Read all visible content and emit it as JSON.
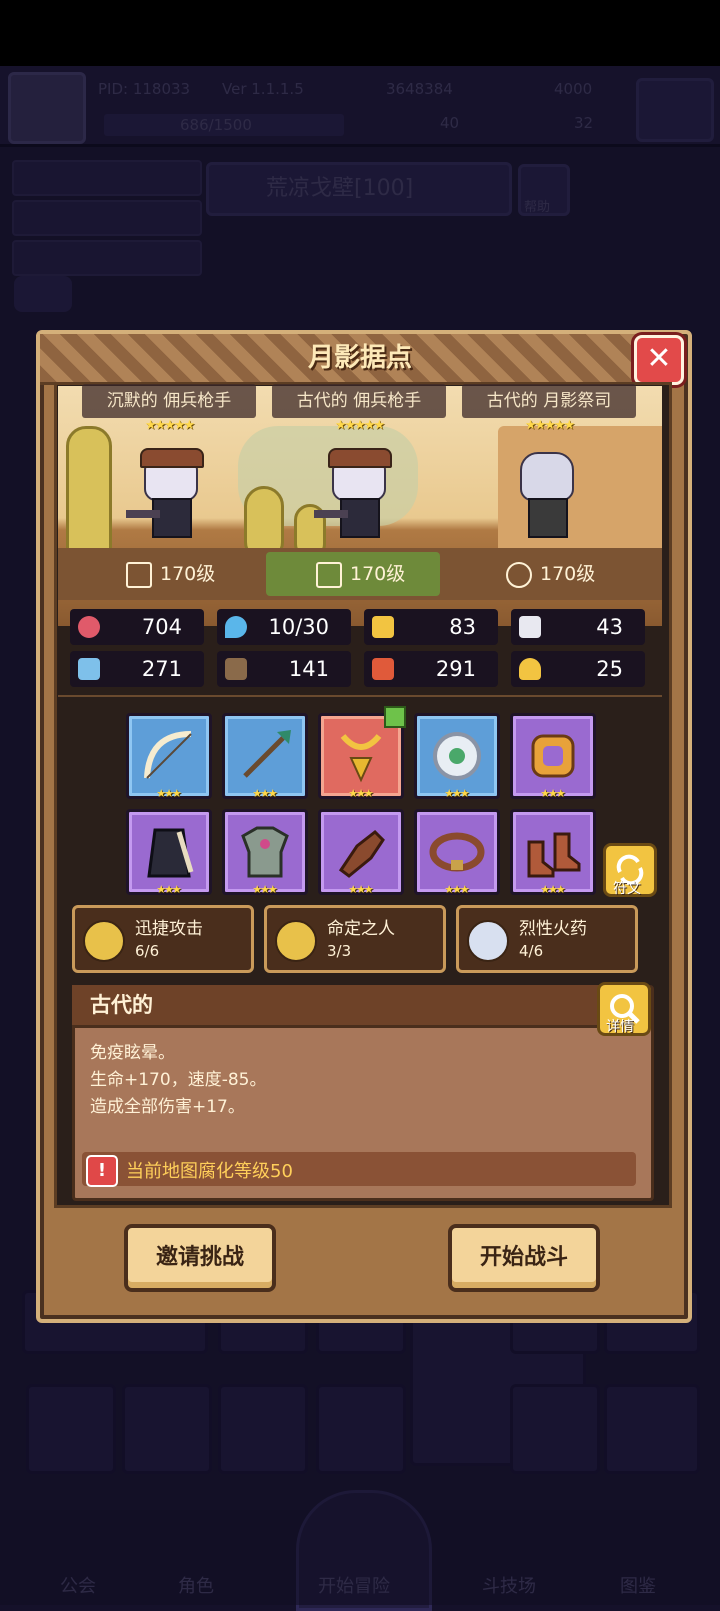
{
  "background": {
    "top_bar": {
      "pid": "PID: 118033",
      "version": "Ver 1.1.1.5",
      "gold": "3648384",
      "gems": "4000",
      "exp": "686/1500",
      "res_a": "40",
      "res_b": "32"
    },
    "map_name": "荒凉戈壁[100]",
    "help_label": "帮助",
    "nav": [
      "公会",
      "角色",
      "开始冒险",
      "斗技场",
      "图鉴"
    ]
  },
  "dialog": {
    "title": "月影据点",
    "units": [
      {
        "name": "沉默的 佣兵枪手",
        "stars": "★★★★★",
        "level": "170级"
      },
      {
        "name": "古代的 佣兵枪手",
        "stars": "★★★★★",
        "level": "170级"
      },
      {
        "name": "古代的 月影祭司",
        "stars": "★★★★★",
        "level": "170级"
      }
    ],
    "stats": [
      {
        "icon": "heart-icon",
        "value": "704",
        "color": "#e05a6a"
      },
      {
        "icon": "mana-drop-icon",
        "value": "10/30",
        "color": "#5ab6ea"
      },
      {
        "icon": "shield-icon",
        "value": "83",
        "color": "#f2c441"
      },
      {
        "icon": "wing-icon",
        "value": "43",
        "color": "#e8e8f0"
      },
      {
        "icon": "fist-icon",
        "value": "271",
        "color": "#7ec0ea"
      },
      {
        "icon": "book-icon",
        "value": "141",
        "color": "#8a6a4a"
      },
      {
        "icon": "boot-icon",
        "value": "291",
        "color": "#e05a3a"
      },
      {
        "icon": "horseshoe-icon",
        "value": "25",
        "color": "#f2c441"
      }
    ],
    "equipment": [
      {
        "name": "bow-icon",
        "rarity": "blue",
        "stars": "★★★"
      },
      {
        "name": "arrow-icon",
        "rarity": "blue",
        "stars": "★★★"
      },
      {
        "name": "amulet-icon",
        "rarity": "red",
        "stars": "★★★"
      },
      {
        "name": "ring-gem-icon",
        "rarity": "blue",
        "stars": "★★★"
      },
      {
        "name": "ring-icon",
        "rarity": "purple",
        "stars": "★★★"
      },
      {
        "name": "cape-icon",
        "rarity": "purple",
        "stars": "★★★"
      },
      {
        "name": "armor-icon",
        "rarity": "purple",
        "stars": "★★★"
      },
      {
        "name": "glove-icon",
        "rarity": "purple",
        "stars": "★★★"
      },
      {
        "name": "belt-icon",
        "rarity": "purple",
        "stars": "★★★"
      },
      {
        "name": "boots-icon",
        "rarity": "purple",
        "stars": "★★★"
      }
    ],
    "rune_label": "符文",
    "skills": [
      {
        "name": "迅捷攻击",
        "count": "6/6",
        "color": "#e8c14a"
      },
      {
        "name": "命定之人",
        "count": "3/3",
        "color": "#e8c14a"
      },
      {
        "name": "烈性火药",
        "count": "4/6",
        "color": "#d8e0f0"
      }
    ],
    "trait": {
      "title": "古代的",
      "lines": [
        "免疫眩晕。",
        "生命+170，速度-85。",
        "造成全部伤害+17。"
      ],
      "detail_label": "详情"
    },
    "warning": "当前地图腐化等级50",
    "buttons": {
      "invite": "邀请挑战",
      "start": "开始战斗"
    }
  }
}
